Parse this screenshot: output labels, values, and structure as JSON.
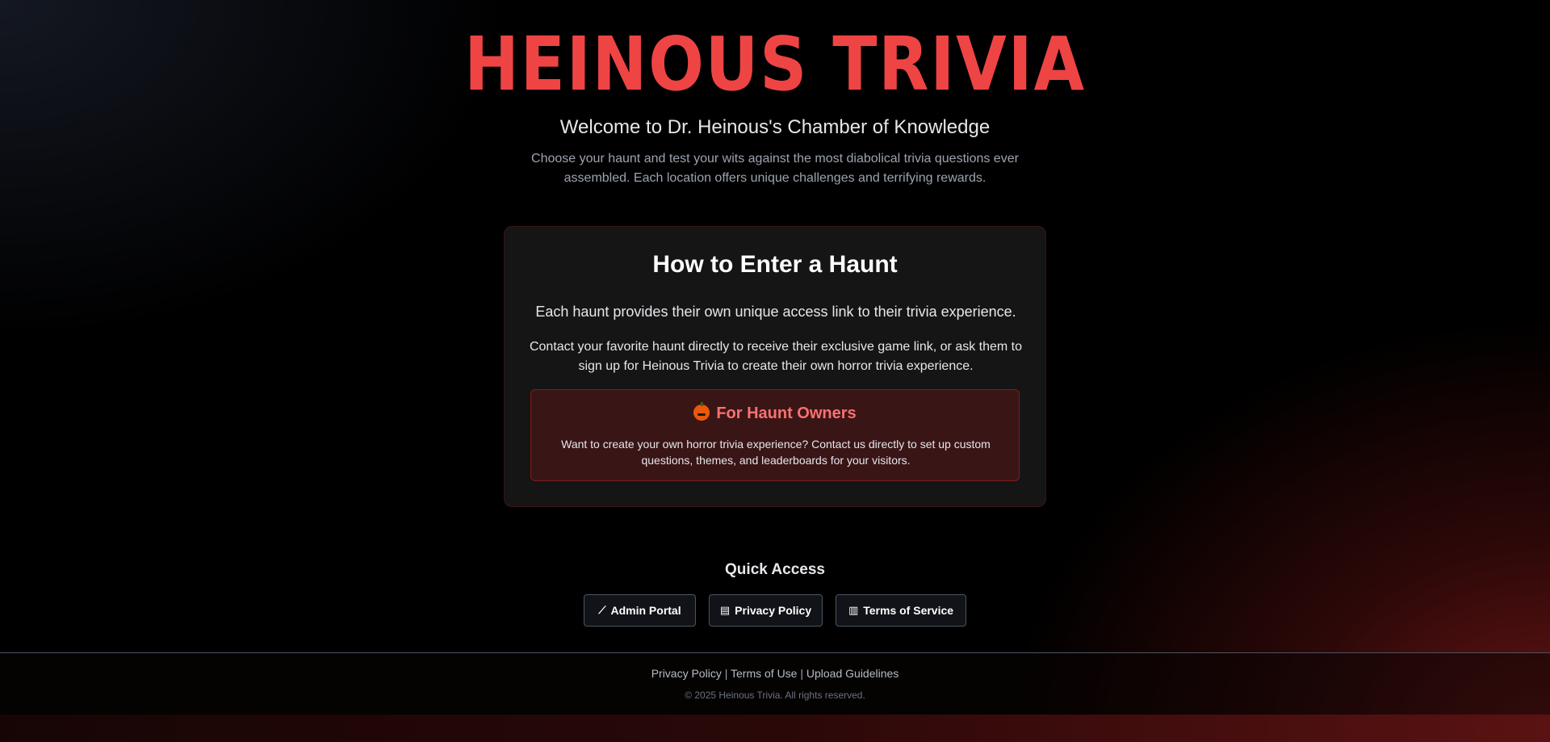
{
  "header": {
    "logo_text": "HEINOUS TRIVIA",
    "welcome": "Welcome to Dr. Heinous's Chamber of Knowledge",
    "intro": "Choose your haunt and test your wits against the most diabolical trivia questions ever assembled. Each location offers unique challenges and terrifying rewards."
  },
  "card": {
    "title": "How to Enter a Haunt",
    "paragraph1": "Each haunt provides their own unique access link to their trivia experience.",
    "paragraph2": "Contact your favorite haunt directly to receive their exclusive game link, or ask them to sign up for Heinous Trivia to create their own horror trivia experience.",
    "owners": {
      "icon": "pumpkin-icon",
      "title": "For Haunt Owners",
      "text": "Want to create your own horror trivia experience? Contact us directly to set up custom questions, themes, and leaderboards for your visitors."
    }
  },
  "quick_access": {
    "title": "Quick Access",
    "buttons": [
      {
        "icon": "wand-icon",
        "label": "Admin Portal"
      },
      {
        "icon": "clipboard-icon",
        "label": "Privacy Policy"
      },
      {
        "icon": "scroll-icon",
        "label": "Terms of Service"
      }
    ]
  },
  "footer": {
    "links": [
      "Privacy Policy",
      "Terms of Use",
      "Upload Guidelines"
    ],
    "separator": "|",
    "copyright": "© 2025 Heinous Trivia. All rights reserved."
  },
  "colors": {
    "accent": "#ef4444",
    "owners_title": "#f87171",
    "card_bg": "#171717"
  }
}
